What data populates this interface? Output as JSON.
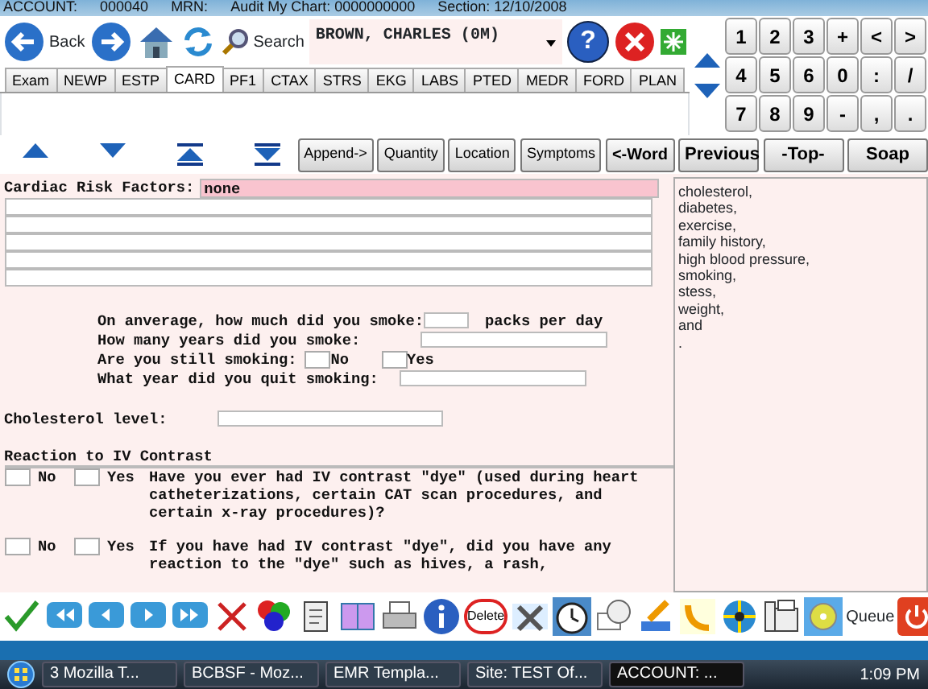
{
  "title_bar": {
    "account_label": "ACCOUNT:",
    "account": "000040",
    "mrn_label": "MRN:",
    "audit": "Audit My Chart: 0000000000",
    "section": "Section: 12/10/2008"
  },
  "toolbar": {
    "back": "Back",
    "search": "Search",
    "patient": "BROWN, CHARLES  (0M)",
    "help": "?"
  },
  "keypad": [
    [
      "1",
      "2",
      "3",
      "+",
      "<",
      ">"
    ],
    [
      "4",
      "5",
      "6",
      "0",
      ":",
      "/"
    ],
    [
      "7",
      "8",
      "9",
      "-",
      ",",
      "."
    ]
  ],
  "tabs": [
    {
      "label": "Exam",
      "selected": false
    },
    {
      "label": "NEWP",
      "selected": false
    },
    {
      "label": "ESTP",
      "selected": false
    },
    {
      "label": "CARD",
      "selected": true
    },
    {
      "label": "PF1",
      "selected": false
    },
    {
      "label": "CTAX",
      "selected": false
    },
    {
      "label": "STRS",
      "selected": false
    },
    {
      "label": "EKG",
      "selected": false
    },
    {
      "label": "LABS",
      "selected": false
    },
    {
      "label": "PTED",
      "selected": false
    },
    {
      "label": "MEDR",
      "selected": false
    },
    {
      "label": "FORD",
      "selected": false
    },
    {
      "label": "PLAN",
      "selected": false
    }
  ],
  "action_buttons": [
    "Append->",
    "Quantity",
    "Location",
    "Symptoms",
    "<-Word"
  ],
  "nav_buttons": [
    "Previous",
    "-Top-",
    "Soap"
  ],
  "risk_factors": {
    "label": "Cardiac Risk Factors:",
    "value": "none"
  },
  "smoking": {
    "amount_label": "On anverage, how much did you smoke:",
    "amount_unit": "packs per day",
    "years_label": "How many years did you smoke:",
    "still_label": "Are you still smoking:",
    "still_options": [
      {
        "label": "No",
        "checked": false
      },
      {
        "label": "Yes",
        "checked": false
      }
    ],
    "quit_label": "What year did you quit smoking:"
  },
  "cholesterol_label": "Cholesterol level:",
  "contrast": {
    "heading": "Reaction to IV Contrast",
    "questions": [
      {
        "no": "No",
        "no_checked": false,
        "yes": "Yes",
        "yes_checked": false,
        "text": "Have you ever had IV contrast \"dye\" (used during heart catheterizations, certain CAT scan procedures, and certain x-ray procedures)?"
      },
      {
        "no": "No",
        "no_checked": false,
        "yes": "Yes",
        "yes_checked": false,
        "text": "If you have had IV contrast \"dye\", did you have any reaction to the \"dye\" such as hives, a rash,"
      }
    ]
  },
  "choices": [
    "cholesterol,",
    "diabetes,",
    "exercise,",
    "family history,",
    "high blood pressure,",
    "smoking,",
    "stess,",
    "weight,",
    "and",
    "."
  ],
  "bottom_toolbar": {
    "delete": "Delete",
    "queue": "Queue"
  },
  "taskbar": {
    "items": [
      {
        "label": "3 Mozilla T...",
        "selected": false
      },
      {
        "label": "BCBSF - Moz...",
        "selected": false
      },
      {
        "label": "EMR Templa...",
        "selected": false
      },
      {
        "label": "Site: TEST Of...",
        "selected": false
      },
      {
        "label": "ACCOUNT: ...",
        "selected": true
      }
    ],
    "clock": "1:09 PM"
  }
}
